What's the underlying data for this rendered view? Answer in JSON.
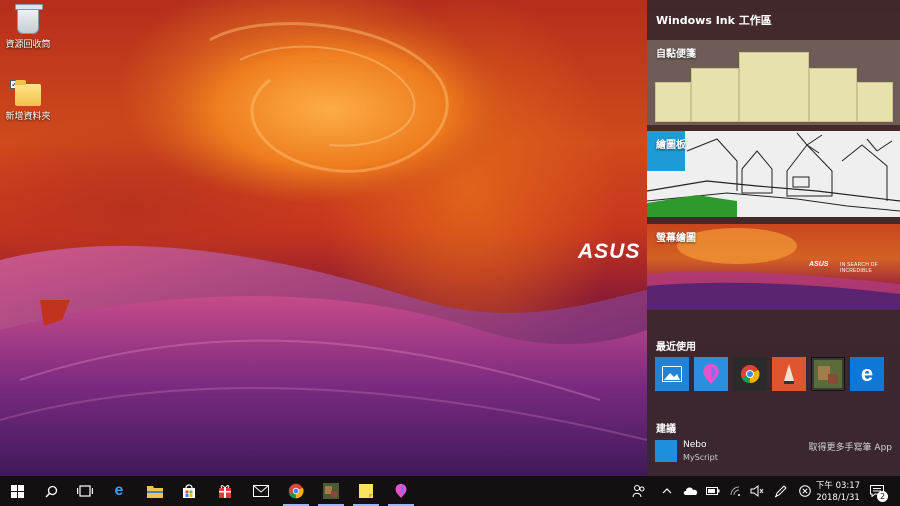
{
  "desktop": {
    "icons": [
      {
        "label": "資源回收筒",
        "icon": "recycle-bin-icon"
      },
      {
        "label": "新增資料夾",
        "icon": "folder-icon"
      }
    ],
    "wallpaper_brand": "ASUS"
  },
  "ink_workspace": {
    "title": "Windows Ink 工作區",
    "cards": {
      "sticky_notes": "自黏便箋",
      "sketchpad": "繪圖板",
      "screen_sketch": "螢幕繪圖"
    },
    "screen_preview": {
      "brand": "ASUS",
      "tagline": "IN SEARCH OF INCREDIBLE"
    },
    "recent_heading": "最近使用",
    "recent_apps": [
      {
        "name": "photos",
        "icon": "photos-icon",
        "color": "#1f83d9"
      },
      {
        "name": "paint-3d",
        "icon": "paint3d-icon",
        "color": "#2a8fe0"
      },
      {
        "name": "chrome",
        "icon": "chrome-icon",
        "color": "#2b2b2b"
      },
      {
        "name": "sketchbook",
        "icon": "sketchbook-icon",
        "color": "#e1552e"
      },
      {
        "name": "image-viewer",
        "icon": "image-thumbnail-icon",
        "color": "#3a3a3a"
      },
      {
        "name": "edge",
        "icon": "edge-icon",
        "color": "#0f78d7"
      }
    ],
    "suggest_heading": "建議",
    "suggestion": {
      "name": "Nebo",
      "publisher": "MyScript",
      "color": "#1e8fdd"
    },
    "more_apps_link": "取得更多手寫筆 App"
  },
  "taskbar": {
    "items": [
      {
        "icon": "start-windows-icon"
      },
      {
        "icon": "search-icon"
      },
      {
        "icon": "task-view-icon"
      },
      {
        "icon": "edge-icon"
      },
      {
        "icon": "file-explorer-icon"
      },
      {
        "icon": "store-icon"
      },
      {
        "icon": "gift-icon"
      },
      {
        "icon": "mail-icon"
      },
      {
        "icon": "chrome-icon"
      },
      {
        "icon": "image-viewer-icon"
      },
      {
        "icon": "sticky-notes-icon"
      },
      {
        "icon": "paint3d-icon"
      }
    ],
    "tray": {
      "clock_ampm_time": "下午 03:17",
      "date": "2018/1/31",
      "notification_count": "2"
    },
    "accent_color": "#9ab8ff"
  }
}
